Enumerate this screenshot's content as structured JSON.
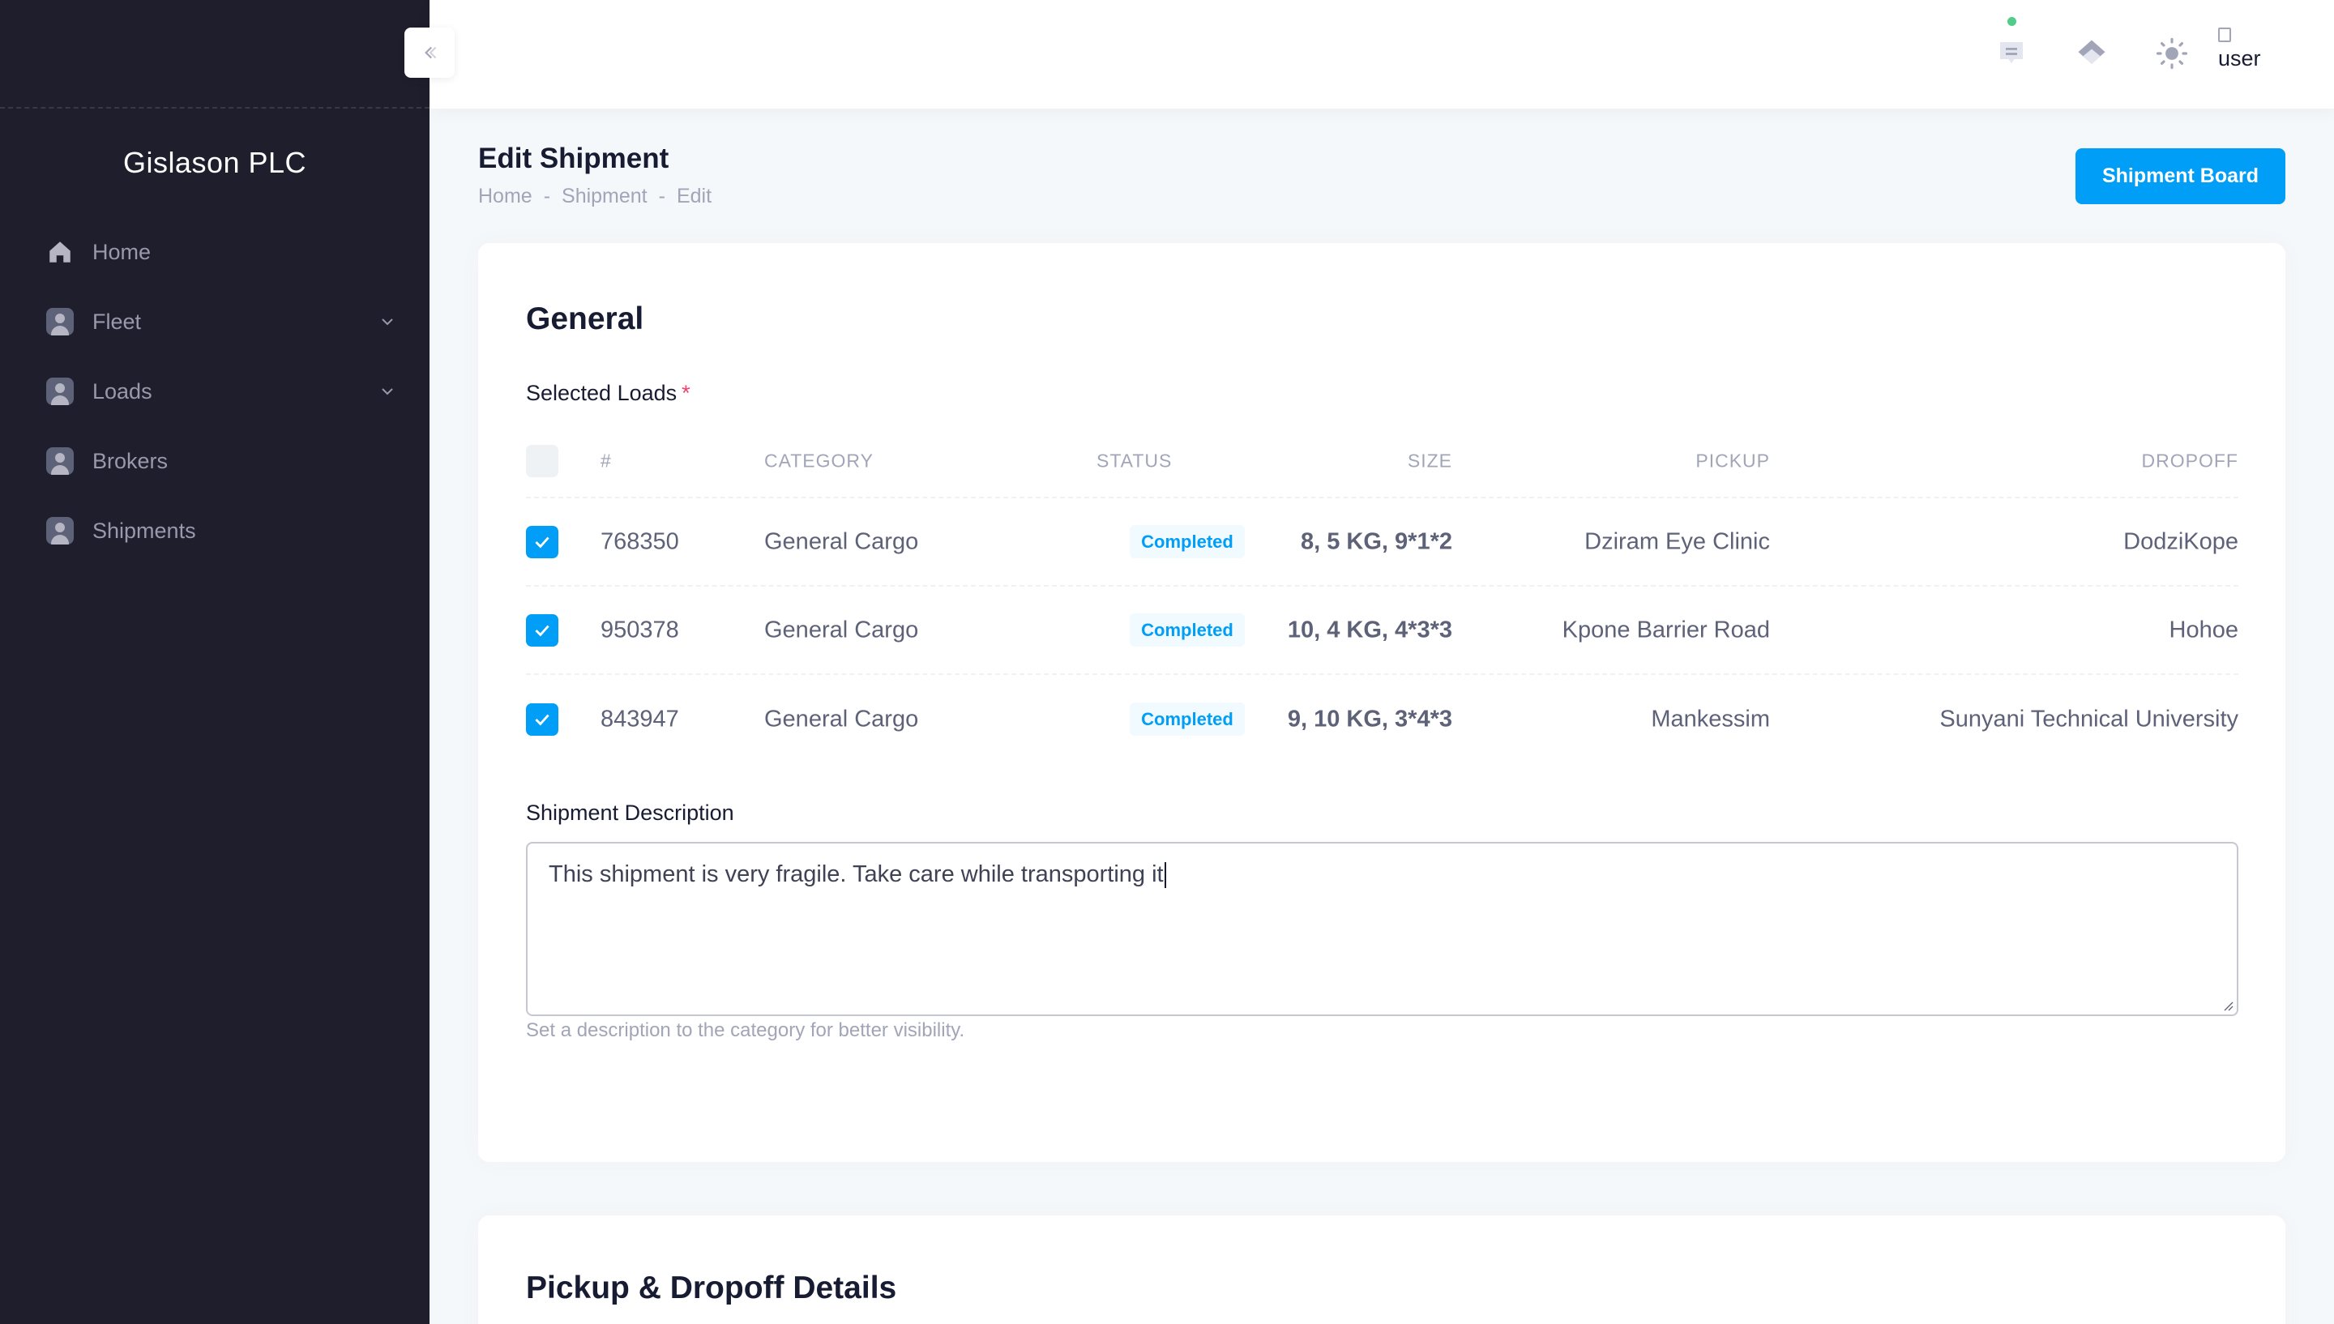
{
  "sidebar": {
    "org_name": "Gislason PLC",
    "items": [
      {
        "label": "Home",
        "icon": "home-icon",
        "has_children": false
      },
      {
        "label": "Fleet",
        "icon": "avatar-icon",
        "has_children": true
      },
      {
        "label": "Loads",
        "icon": "avatar-icon",
        "has_children": true
      },
      {
        "label": "Brokers",
        "icon": "avatar-icon",
        "has_children": false
      },
      {
        "label": "Shipments",
        "icon": "avatar-icon",
        "has_children": false
      }
    ]
  },
  "header": {
    "icons": [
      "chat-icon",
      "layers-icon",
      "sun-icon"
    ],
    "user_alt": "user"
  },
  "toolbar": {
    "title": "Edit Shipment",
    "breadcrumb": [
      "Home",
      "Shipment",
      "Edit"
    ],
    "action_label": "Shipment Board"
  },
  "general": {
    "title": "General",
    "selected_loads_label": "Selected Loads",
    "required_mark": "*",
    "columns": [
      "#",
      "CATEGORY",
      "STATUS",
      "SIZE",
      "PICKUP",
      "DROPOFF"
    ],
    "rows": [
      {
        "id": "768350",
        "category": "General Cargo",
        "status": "Completed",
        "size": "8, 5 KG, 9*1*2",
        "pickup": "Dziram Eye Clinic",
        "dropoff": "DodziKope",
        "checked": true
      },
      {
        "id": "950378",
        "category": "General Cargo",
        "status": "Completed",
        "size": "10, 4 KG, 4*3*3",
        "pickup": "Kpone Barrier Road",
        "dropoff": "Hohoe",
        "checked": true
      },
      {
        "id": "843947",
        "category": "General Cargo",
        "status": "Completed",
        "size": "9, 10 KG, 3*4*3",
        "pickup": "Mankessim",
        "dropoff": "Sunyani Technical University",
        "checked": true
      }
    ],
    "description_label": "Shipment Description",
    "description_value": "This shipment is very fragile. Take care while transporting it",
    "description_help": "Set a description to the category for better visibility."
  },
  "pickup_section": {
    "title": "Pickup & Dropoff Details"
  },
  "colors": {
    "primary": "#009ef7",
    "sidebar_bg": "#1e1e2d",
    "success": "#50cd89",
    "danger": "#f1416c"
  }
}
